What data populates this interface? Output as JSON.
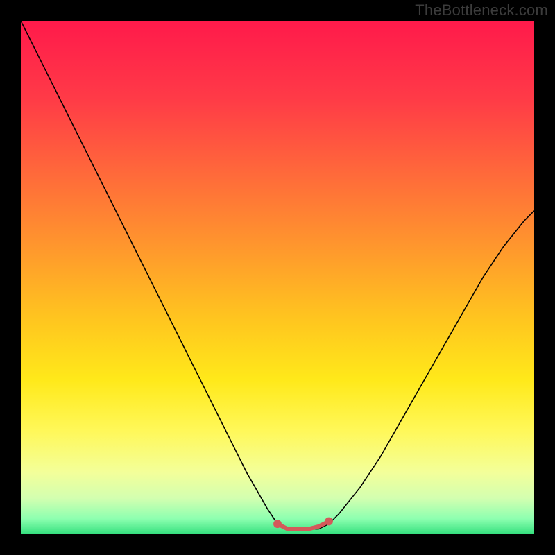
{
  "watermark": "TheBottleneck.com",
  "chart_data": {
    "type": "line",
    "title": "",
    "xlabel": "",
    "ylabel": "",
    "xlim": [
      0,
      100
    ],
    "ylim": [
      0,
      100
    ],
    "gradient_stops": [
      {
        "offset": 0.0,
        "color": "#ff1a4b"
      },
      {
        "offset": 0.15,
        "color": "#ff3a47"
      },
      {
        "offset": 0.3,
        "color": "#ff6a3a"
      },
      {
        "offset": 0.45,
        "color": "#ff9a2c"
      },
      {
        "offset": 0.58,
        "color": "#ffc51f"
      },
      {
        "offset": 0.7,
        "color": "#ffe91a"
      },
      {
        "offset": 0.8,
        "color": "#fff85a"
      },
      {
        "offset": 0.88,
        "color": "#f3ff9a"
      },
      {
        "offset": 0.93,
        "color": "#d3ffb0"
      },
      {
        "offset": 0.97,
        "color": "#8dffb0"
      },
      {
        "offset": 1.0,
        "color": "#35e07e"
      }
    ],
    "series": [
      {
        "name": "curve",
        "color": "#000000",
        "width": 1.6,
        "x": [
          0,
          4,
          8,
          12,
          16,
          20,
          24,
          28,
          32,
          36,
          40,
          44,
          48,
          50,
          52,
          56,
          58,
          60,
          62,
          66,
          70,
          74,
          78,
          82,
          86,
          90,
          94,
          98,
          100
        ],
        "y": [
          100,
          92,
          84,
          76,
          68,
          60,
          52,
          44,
          36,
          28,
          20,
          12,
          5,
          2,
          1,
          1,
          1,
          2,
          4,
          9,
          15,
          22,
          29,
          36,
          43,
          50,
          56,
          61,
          63
        ]
      },
      {
        "name": "valley-marker",
        "color": "#d35a5a",
        "width": 6,
        "endcap_radius": 5,
        "x": [
          50,
          52,
          54,
          56,
          58,
          60
        ],
        "y": [
          2.0,
          1.0,
          1.0,
          1.0,
          1.5,
          2.5
        ]
      }
    ]
  }
}
